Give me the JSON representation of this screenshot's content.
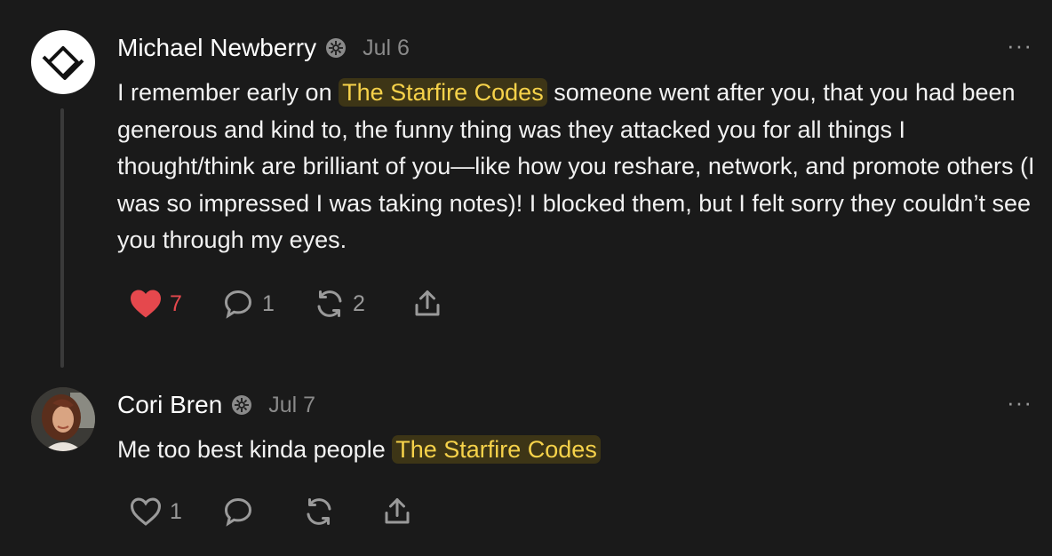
{
  "comments": [
    {
      "author": "Michael Newberry",
      "date": "Jul 6",
      "more_label": "···",
      "text_before": "I remember early on ",
      "mention": "The Starfire Codes",
      "text_after": " someone went after you, that you had been generous and kind to, the funny thing was they attacked you for all things I thought/think are brilliant of you—like how you reshare, network, and promote others (I was so impressed I was taking notes)! I blocked them, but I felt sorry they couldn’t see you through my eyes.",
      "likes": "7",
      "liked": true,
      "replies": "1",
      "restacks": "2"
    },
    {
      "author": "Cori Bren",
      "date": "Jul 7",
      "more_label": "···",
      "text_before": "Me too best kinda people ",
      "mention": "The Starfire Codes",
      "likes": "1",
      "liked": false
    }
  ],
  "colors": {
    "background": "#1a1a1a",
    "mention_bg": "#3d3516",
    "mention_text": "#f6d24a",
    "like_active": "#e5484d",
    "muted": "#9a9a9a"
  },
  "icons": [
    "heart-icon",
    "comment-icon",
    "restack-icon",
    "share-icon",
    "verified-badge-icon",
    "more-icon"
  ]
}
